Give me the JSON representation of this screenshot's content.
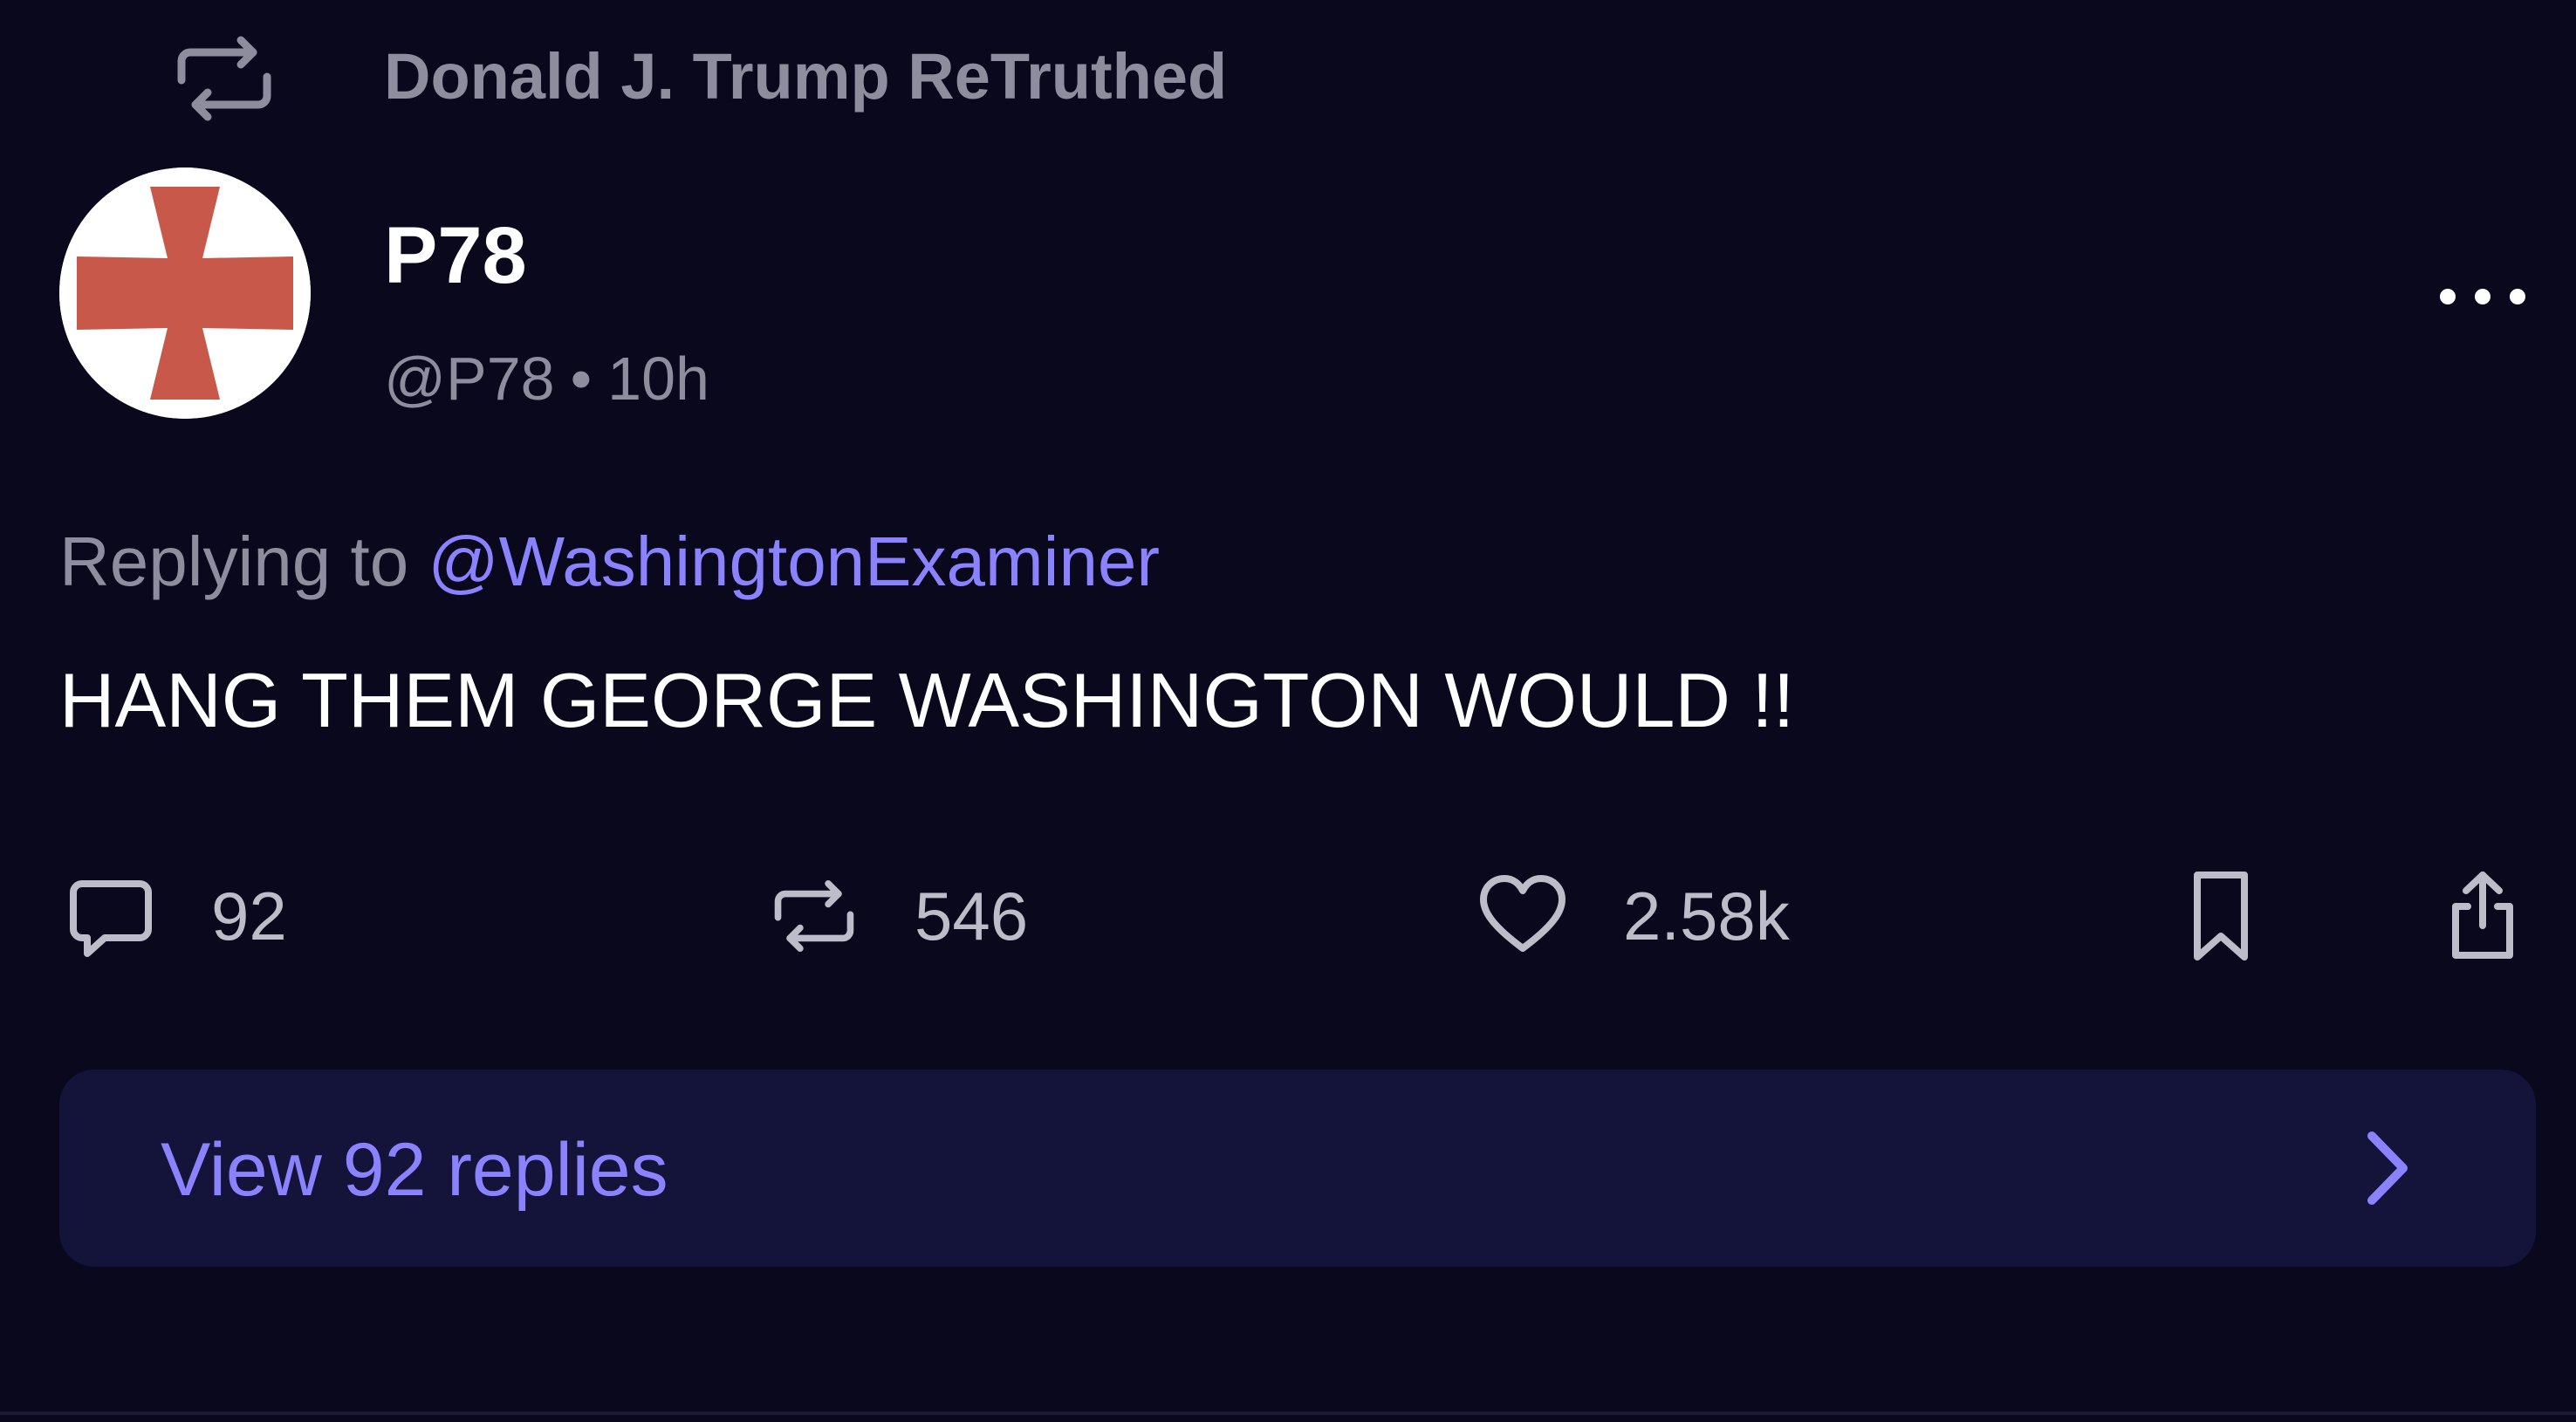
{
  "retruth": {
    "label": "Donald J. Trump ReTruthed",
    "icon": "repost-icon"
  },
  "author": {
    "display_name": "P78",
    "handle": "@P78",
    "separator": "•",
    "time": "10h",
    "avatar_icon": "red-cross-avatar"
  },
  "post": {
    "replying_prefix": "Replying to",
    "replying_to": "@WashingtonExaminer",
    "text": "HANG THEM GEORGE WASHINGTON WOULD !!"
  },
  "actions": {
    "replies": "92",
    "reposts": "546",
    "likes": "2.58k"
  },
  "view_replies": {
    "label": "View 92 replies"
  },
  "colors": {
    "background": "#09081c",
    "muted_text": "#8e8d9e",
    "accent": "#8b82ff",
    "card": "#14133a",
    "avatar_cross": "#c8584a"
  }
}
